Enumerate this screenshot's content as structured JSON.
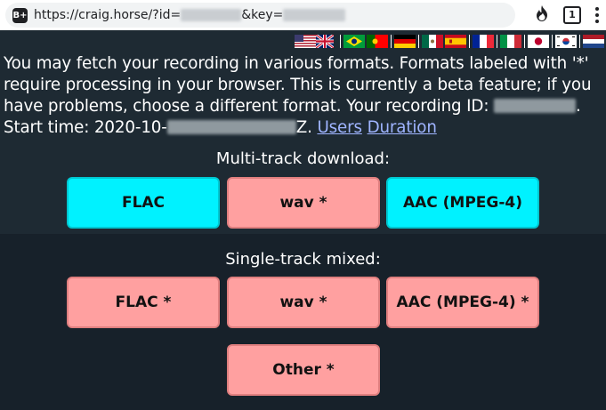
{
  "browser": {
    "site_icon": "B+",
    "url_prefix": "https://craig.horse/?id=",
    "url_middle": "&key=",
    "tab_count": "1",
    "icons": [
      "fire-icon",
      "tab-switcher-icon",
      "menu-dots-icon"
    ]
  },
  "languages": [
    "en-us-gb",
    "pt-br-pt",
    "de",
    "es-mx-es",
    "fr",
    "it",
    "ja",
    "ko",
    "nl"
  ],
  "intro": {
    "text_before_id": "You may fetch your recording in various formats. Formats labeled with '*' require processing in your browser. This is currently a beta feature; if you have problems, choose a different format. Your recording ID: ",
    "text_after_id": ". Start time: 2020-10-",
    "text_after_time": "Z. ",
    "users_link": "Users",
    "duration_link": "Duration"
  },
  "multi_track": {
    "title": "Multi-track download:",
    "buttons": [
      "FLAC",
      "wav *",
      "AAC (MPEG-4)"
    ]
  },
  "single_track": {
    "title": "Single-track mixed:",
    "buttons": [
      "FLAC *",
      "wav *",
      "AAC (MPEG-4) *",
      "Other *"
    ]
  },
  "colors": {
    "page_bg": "#1e2a33",
    "native_button": "#00f2ff",
    "browser_processed_button": "#ffa0a0",
    "link": "#9fb4ff"
  }
}
